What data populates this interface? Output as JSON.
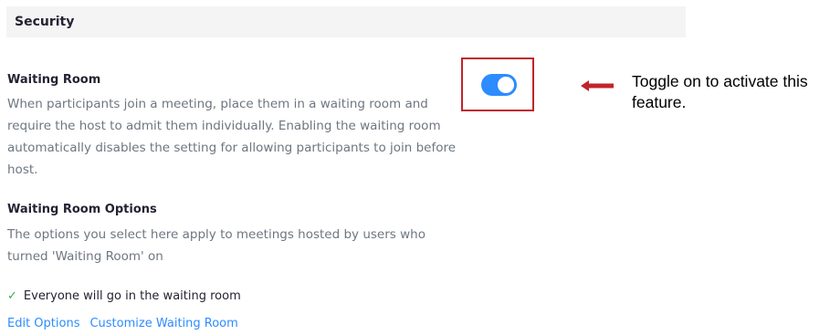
{
  "section": {
    "title": "Security"
  },
  "waiting_room": {
    "title": "Waiting Room",
    "description": "When participants join a meeting, place them in a waiting room and require the host to admit them individually. Enabling the waiting room automatically disables the setting for allowing participants to join before host.",
    "toggle_on": true
  },
  "waiting_room_options": {
    "title": "Waiting Room Options",
    "description": "The options you select here apply to meetings hosted by users who turned 'Waiting Room' on",
    "selected_option": "Everyone will go in the waiting room"
  },
  "links": {
    "edit": "Edit Options",
    "customize": "Customize Waiting Room"
  },
  "annotation": {
    "text": "Toggle on to activate this feature."
  },
  "colors": {
    "accent": "#2d8cff",
    "highlight_box": "#c0242b",
    "check": "#3dae4a"
  },
  "icons": {
    "check": "check-icon",
    "arrow": "left-arrow-icon"
  }
}
